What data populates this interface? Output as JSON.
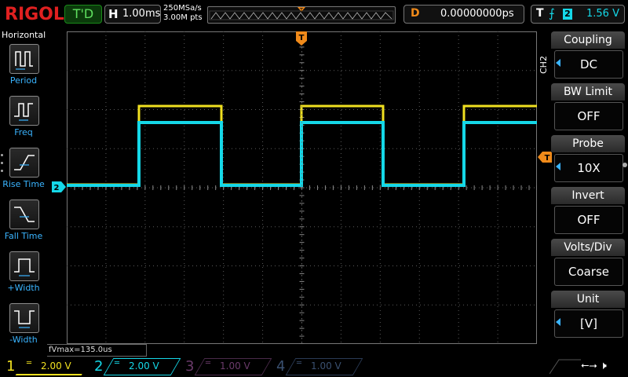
{
  "brand": "RIGOL",
  "status": {
    "trigger_state": "T'D"
  },
  "horizontal": {
    "key": "H",
    "timebase": "1.00ms",
    "sample_rate": "250MSa/s",
    "memory_depth": "3.00M pts"
  },
  "delay": {
    "key": "D",
    "value": "0.00000000ps"
  },
  "trigger": {
    "key": "T",
    "source": "2",
    "level": "1.56 V",
    "edge_icon": "rising-edge-icon"
  },
  "left_menu": {
    "title": "Horizontal",
    "items": [
      {
        "label": "Period",
        "icon": "period-icon"
      },
      {
        "label": "Freq",
        "icon": "frequency-icon"
      },
      {
        "label": "Rise Time",
        "icon": "rise-time-icon"
      },
      {
        "label": "Fall Time",
        "icon": "fall-time-icon"
      },
      {
        "label": "+Width",
        "icon": "positive-width-icon"
      },
      {
        "label": "-Width",
        "icon": "negative-width-icon"
      }
    ]
  },
  "right_menu": {
    "channel_tag": "CH2",
    "items": [
      {
        "title": "Coupling",
        "value": "DC"
      },
      {
        "title": "BW Limit",
        "value": "OFF"
      },
      {
        "title": "Probe",
        "value": "10X"
      },
      {
        "title": "Invert",
        "value": "OFF"
      },
      {
        "title": "Volts/Div",
        "value": "Coarse"
      },
      {
        "title": "Unit",
        "value": "[V]"
      }
    ]
  },
  "measurement": {
    "text": "fVmax=135.0us"
  },
  "waveform_markers": {
    "ch2_marker": "2",
    "trigger_level_marker": "T",
    "trigger_position_marker": "T"
  },
  "channels": [
    {
      "num": "1",
      "scale": "2.00 V",
      "color": "#f0e020",
      "active": true
    },
    {
      "num": "2",
      "scale": "2.00 V",
      "color": "#15d8e8",
      "active": true
    },
    {
      "num": "3",
      "scale": "1.00 V",
      "color": "#c040c0",
      "active": false
    },
    {
      "num": "4",
      "scale": "1.00 V",
      "color": "#3a7ad8",
      "active": false
    }
  ],
  "colors": {
    "ch1": "#f0e020",
    "ch2": "#15d8e8",
    "trigger": "#f08a1a",
    "menu_accent": "#3ab4ff",
    "grid": "#5a5a5a"
  }
}
